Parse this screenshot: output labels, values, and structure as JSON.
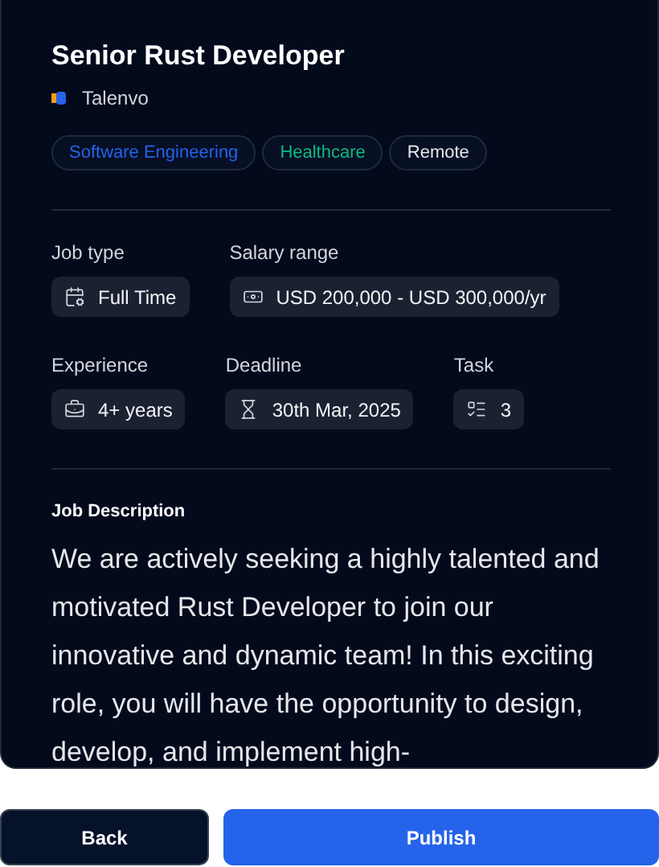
{
  "job": {
    "title": "Senior Rust Developer",
    "company": "Talenvo"
  },
  "tags": [
    {
      "label": "Software Engineering",
      "color": "#2563eb"
    },
    {
      "label": "Healthcare",
      "color": "#10b981"
    },
    {
      "label": "Remote",
      "color": "#e5e7eb"
    }
  ],
  "details": [
    [
      {
        "label": "Job type",
        "value": "Full Time",
        "kind": "calendar"
      },
      {
        "label": "Salary range",
        "value": "USD 200,000 - USD 300,000/yr",
        "kind": "money"
      }
    ],
    [
      {
        "label": "Experience",
        "value": "4+ years",
        "kind": "briefcase"
      },
      {
        "label": "Deadline",
        "value": "30th Mar, 2025",
        "kind": "hourglass"
      },
      {
        "label": "Task",
        "value": "3",
        "kind": "task"
      }
    ]
  ],
  "description": {
    "heading": "Job Description",
    "text": "We are actively seeking a highly talented and motivated Rust Developer to join our innovative and dynamic team! In this exciting role, you will have the opportunity to design, develop, and implement high-"
  },
  "buttons": [
    {
      "label": "Back",
      "kind": "secondary"
    },
    {
      "label": "Publish",
      "kind": "primary"
    }
  ]
}
